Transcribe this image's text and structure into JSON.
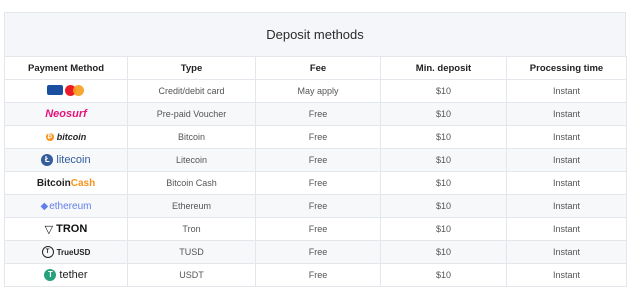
{
  "table": {
    "caption": "Deposit methods",
    "headers": {
      "payment_method": "Payment Method",
      "type": "Type",
      "fee": "Fee",
      "min_deposit": "Min. deposit",
      "processing_time": "Processing time"
    },
    "rows": [
      {
        "logo": "visa-mastercard-logo",
        "type": "Credit/debit card",
        "fee": "May apply",
        "min": "$10",
        "time": "Instant"
      },
      {
        "logo": "neosurf-logo",
        "logo_text": "Neosurf",
        "type": "Pre-paid Voucher",
        "fee": "Free",
        "min": "$10",
        "time": "Instant"
      },
      {
        "logo": "bitcoin-logo",
        "logo_text": "bitcoin",
        "type": "Bitcoin",
        "fee": "Free",
        "min": "$10",
        "time": "Instant"
      },
      {
        "logo": "litecoin-logo",
        "logo_text": "litecoin",
        "type": "Litecoin",
        "fee": "Free",
        "min": "$10",
        "time": "Instant"
      },
      {
        "logo": "bitcoincash-logo",
        "logo_text_a": "Bitcoin",
        "logo_text_b": "Cash",
        "type": "Bitcoin Cash",
        "fee": "Free",
        "min": "$10",
        "time": "Instant"
      },
      {
        "logo": "ethereum-logo",
        "logo_text": "ethereum",
        "type": "Ethereum",
        "fee": "Free",
        "min": "$10",
        "time": "Instant"
      },
      {
        "logo": "tron-logo",
        "logo_text": "TRON",
        "type": "Tron",
        "fee": "Free",
        "min": "$10",
        "time": "Instant"
      },
      {
        "logo": "trueusd-logo",
        "logo_text": "TrueUSD",
        "type": "TUSD",
        "fee": "Free",
        "min": "$10",
        "time": "Instant"
      },
      {
        "logo": "tether-logo",
        "logo_text": "tether",
        "type": "USDT",
        "fee": "Free",
        "min": "$10",
        "time": "Instant"
      }
    ]
  },
  "colors": {
    "header_bg": "#f4f6f9",
    "border": "#e3e7ec",
    "neosurf": "#e6137b",
    "bitcoin": "#f7931a",
    "litecoin": "#345d9d",
    "ethereum": "#627eea",
    "tether": "#26a17b"
  }
}
